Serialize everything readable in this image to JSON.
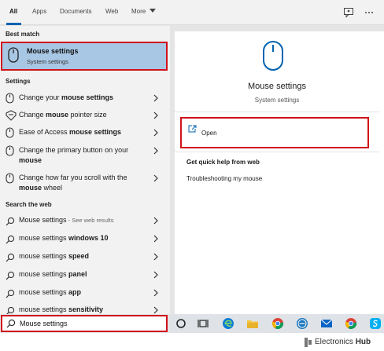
{
  "tabs": [
    {
      "label": "All",
      "active": true
    },
    {
      "label": "Apps"
    },
    {
      "label": "Documents"
    },
    {
      "label": "Web"
    },
    {
      "label": "More"
    }
  ],
  "toolbar_icons": [
    "feedback-icon",
    "more-options-icon"
  ],
  "best_match": {
    "section_label": "Best match",
    "title": "Mouse settings",
    "subtitle": "System settings",
    "icon": "mouse-icon"
  },
  "settings": {
    "section_label": "Settings",
    "items": [
      {
        "pre": "Change your ",
        "bold": "mouse settings",
        "post": "",
        "icon": "toggle-icon"
      },
      {
        "pre": "Change ",
        "bold": "mouse",
        "post": " pointer size",
        "icon": "pointer-icon"
      },
      {
        "pre": "Ease of Access ",
        "bold": "mouse settings",
        "post": "",
        "icon": "mouse-icon"
      },
      {
        "pre": "Change the primary button on your ",
        "bold": "mouse",
        "post": "",
        "icon": "mouse-icon"
      },
      {
        "pre": "Change how far you scroll with the ",
        "bold": "mouse",
        "post": " wheel",
        "icon": "mouse-icon"
      }
    ]
  },
  "web": {
    "section_label": "Search the web",
    "items": [
      {
        "pre": "Mouse settings",
        "bold": "",
        "hint": " - See web results"
      },
      {
        "pre": "mouse settings ",
        "bold": "windows 10",
        "hint": ""
      },
      {
        "pre": "mouse settings ",
        "bold": "speed",
        "hint": ""
      },
      {
        "pre": "mouse settings ",
        "bold": "panel",
        "hint": ""
      },
      {
        "pre": "mouse settings ",
        "bold": "app",
        "hint": ""
      },
      {
        "pre": "mouse settings ",
        "bold": "sensitivity",
        "hint": ""
      }
    ]
  },
  "preview": {
    "title": "Mouse settings",
    "subtitle": "System settings",
    "open_label": "Open",
    "help_heading": "Get quick help from web",
    "help_link": "Troubleshooting my mouse"
  },
  "search": {
    "value": "Mouse settings"
  },
  "taskbar_icons": [
    "cortana-icon",
    "task-view-icon",
    "edge-icon",
    "file-explorer-icon",
    "chrome-icon",
    "dell-icon",
    "mail-icon",
    "chrome-icon",
    "skype-icon"
  ],
  "watermark": {
    "pre": "Electronics ",
    "bold": "Hub"
  },
  "colors": {
    "accent": "#0063b1",
    "highlight": "#a8c7e4",
    "annotation": "#d0121b"
  }
}
